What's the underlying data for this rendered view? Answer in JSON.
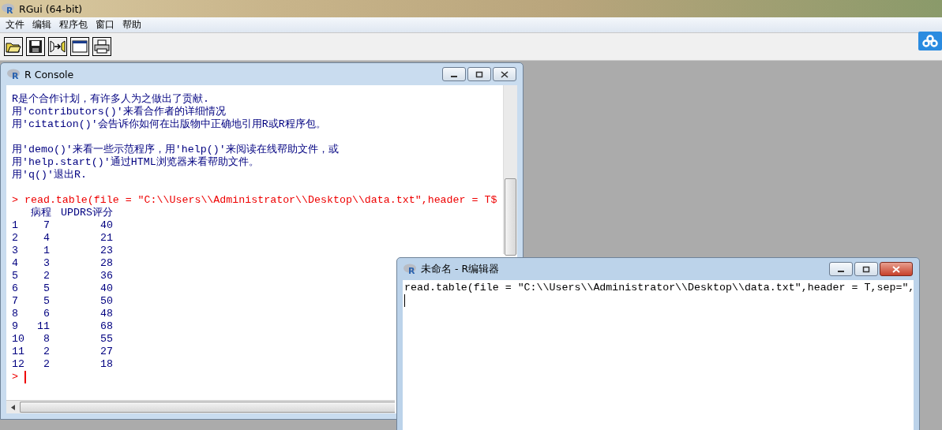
{
  "window": {
    "title": "RGui (64-bit)",
    "logo": "R"
  },
  "menu": [
    "文件",
    "编辑",
    "程序包",
    "窗口",
    "帮助"
  ],
  "console": {
    "title": "R Console",
    "logo": "R",
    "intro": [
      [
        "R是个合作计划，有许多人为之做出了贡献.",
        "用'contributors()'来看合作者的详细情况",
        "用'citation()'会告诉你如何在出版物中正确地引用R或R程序包。"
      ],
      [
        "用'demo()'来看一些示范程序，用'help()'来阅读在线帮助文件，或",
        "用'help.start()'通过HTML浏览器来看帮助文件。",
        "用'q()'退出R."
      ]
    ],
    "prompt": ">",
    "command": "read.table(file = \"C:\\\\Users\\\\Administrator\\\\Desktop\\\\data.txt\",header = T$",
    "table_header": [
      "病程",
      "UPDRS评分"
    ],
    "rows": [
      [
        "1",
        "7",
        "40"
      ],
      [
        "2",
        "4",
        "21"
      ],
      [
        "3",
        "1",
        "23"
      ],
      [
        "4",
        "3",
        "28"
      ],
      [
        "5",
        "2",
        "36"
      ],
      [
        "6",
        "5",
        "40"
      ],
      [
        "7",
        "5",
        "50"
      ],
      [
        "8",
        "6",
        "48"
      ],
      [
        "9",
        "11",
        "68"
      ],
      [
        "10",
        "8",
        "55"
      ],
      [
        "11",
        "2",
        "27"
      ],
      [
        "12",
        "2",
        "18"
      ]
    ],
    "end_prompt": ">"
  },
  "editor": {
    "title": "未命名 - R编辑器",
    "logo": "R",
    "lines": [
      "read.table(file = \"C:\\\\Users\\\\Administrator\\\\Desktop\\\\data.txt\",header = T,sep=\","
    ]
  }
}
